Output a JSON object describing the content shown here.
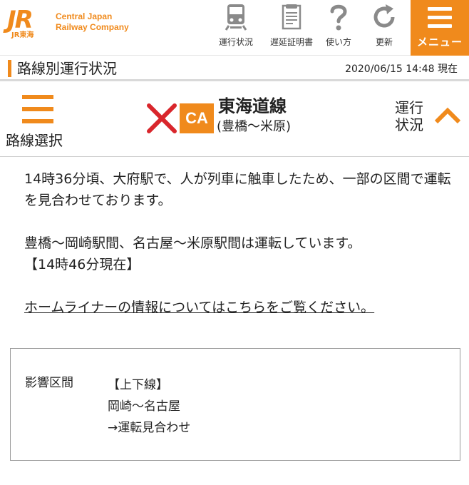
{
  "header": {
    "logo_mark": "JR",
    "logo_sub": "JR東海",
    "logo_line1": "Central Japan",
    "logo_line2": "Railway Company",
    "buttons": [
      {
        "label": "運行状況",
        "icon": "train-icon"
      },
      {
        "label": "遅延証明書",
        "icon": "certificate-icon"
      },
      {
        "label": "使い方",
        "icon": "question-icon"
      },
      {
        "label": "更新",
        "icon": "refresh-icon"
      }
    ],
    "menu_label": "メニュー"
  },
  "titlebar": {
    "title": "路線別運行状況",
    "timestamp": "2020/06/15 14:48 現在"
  },
  "linebar": {
    "route_select_label": "路線選択",
    "status_icon": "x-mark-icon",
    "line_code": "CA",
    "line_name": "東海道線",
    "line_range": "(豊橋〜米原)",
    "status_toggle_label": "運行状況"
  },
  "content": {
    "paragraph1": "14時36分頃、大府駅で、人が列車に触車したため、一部の区間で運転を見合わせております。",
    "paragraph2_line1": "豊橋〜岡崎駅間、名古屋〜米原駅間は運転しています。",
    "paragraph2_line2": "【14時46分現在】",
    "link_text": "ホームライナーの情報についてはこちらをご覧ください。"
  },
  "info_box": {
    "label": "影響区間",
    "direction": "【上下線】",
    "section": "岡崎〜名古屋",
    "status": "→運転見合わせ"
  },
  "colors": {
    "accent": "#f08a1c",
    "alert": "#d9262c"
  }
}
